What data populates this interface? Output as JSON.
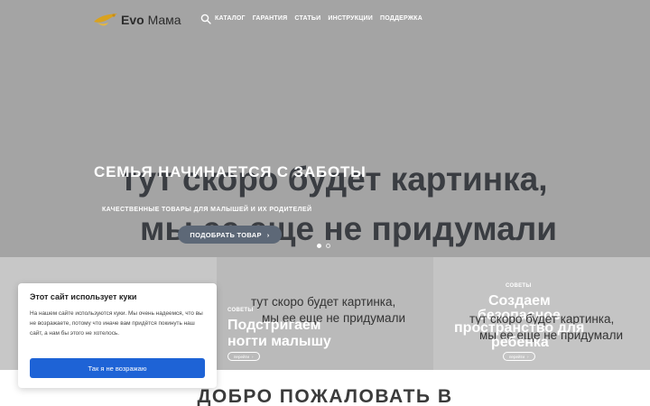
{
  "header": {
    "logo_bold": "Evo",
    "logo_regular": "Мама",
    "search_icon": "search-icon",
    "nav": [
      {
        "label": "КАТАЛОГ"
      },
      {
        "label": "ГАРАНТИЯ"
      },
      {
        "label": "СТАТЬИ"
      },
      {
        "label": "ИНСТРУКЦИИ"
      },
      {
        "label": "ПОДДЕРЖКА"
      }
    ]
  },
  "hero": {
    "placeholder_line1": "тут скоро будет картинка,",
    "placeholder_line2": "мы ее еще не придумали",
    "title": "СЕМЬЯ НАЧИНАЕТСЯ С ЗАБОТЫ",
    "subtitle": "КАЧЕСТВЕННЫЕ ТОВАРЫ ДЛЯ МАЛЫШЕЙ И ИХ РОДИТЕЛЕЙ",
    "button_label": "ПОДОБРАТЬ ТОВАР",
    "button_arrow": "›",
    "slides_count": 2,
    "active_slide": 1
  },
  "cards": [
    {
      "placeholder_line1": "",
      "placeholder_line2": ""
    },
    {
      "placeholder_line1": "тут скоро будет картинка,",
      "placeholder_line2": "мы ее еще не придумали",
      "tag": "СОВЕТЫ",
      "title_line1": "Подстригаем",
      "title_line2": "ногти малышу",
      "button_label": "перейти",
      "button_arrow": "›"
    },
    {
      "placeholder_line1": "тут скоро будет картинка,",
      "placeholder_line2": "мы ее еще не придумали",
      "tag": "СОВЕТЫ",
      "title_line1": "Создаем",
      "title_line2": "безопасное",
      "title_line3": "пространство для",
      "title_line4": "ребенка",
      "button_label": "перейти",
      "button_arrow": "›"
    }
  ],
  "cookie": {
    "title": "Этот сайт использует куки",
    "text": "На нашем сайте используются куки. Мы очень надеемся, что вы не возражаете, потому что иначе вам придётся покинуть наш сайт, а нам бы этого не хотелось.",
    "button_label": "Так я не возражаю"
  },
  "welcome": {
    "title": "ДОБРО ПОЖАЛОВАТЬ В"
  },
  "colors": {
    "hero_bg": "#a4a4a4",
    "accent_button": "#5d6877",
    "cookie_button": "#1e63d6",
    "logo_gold": "#d9a21e"
  }
}
